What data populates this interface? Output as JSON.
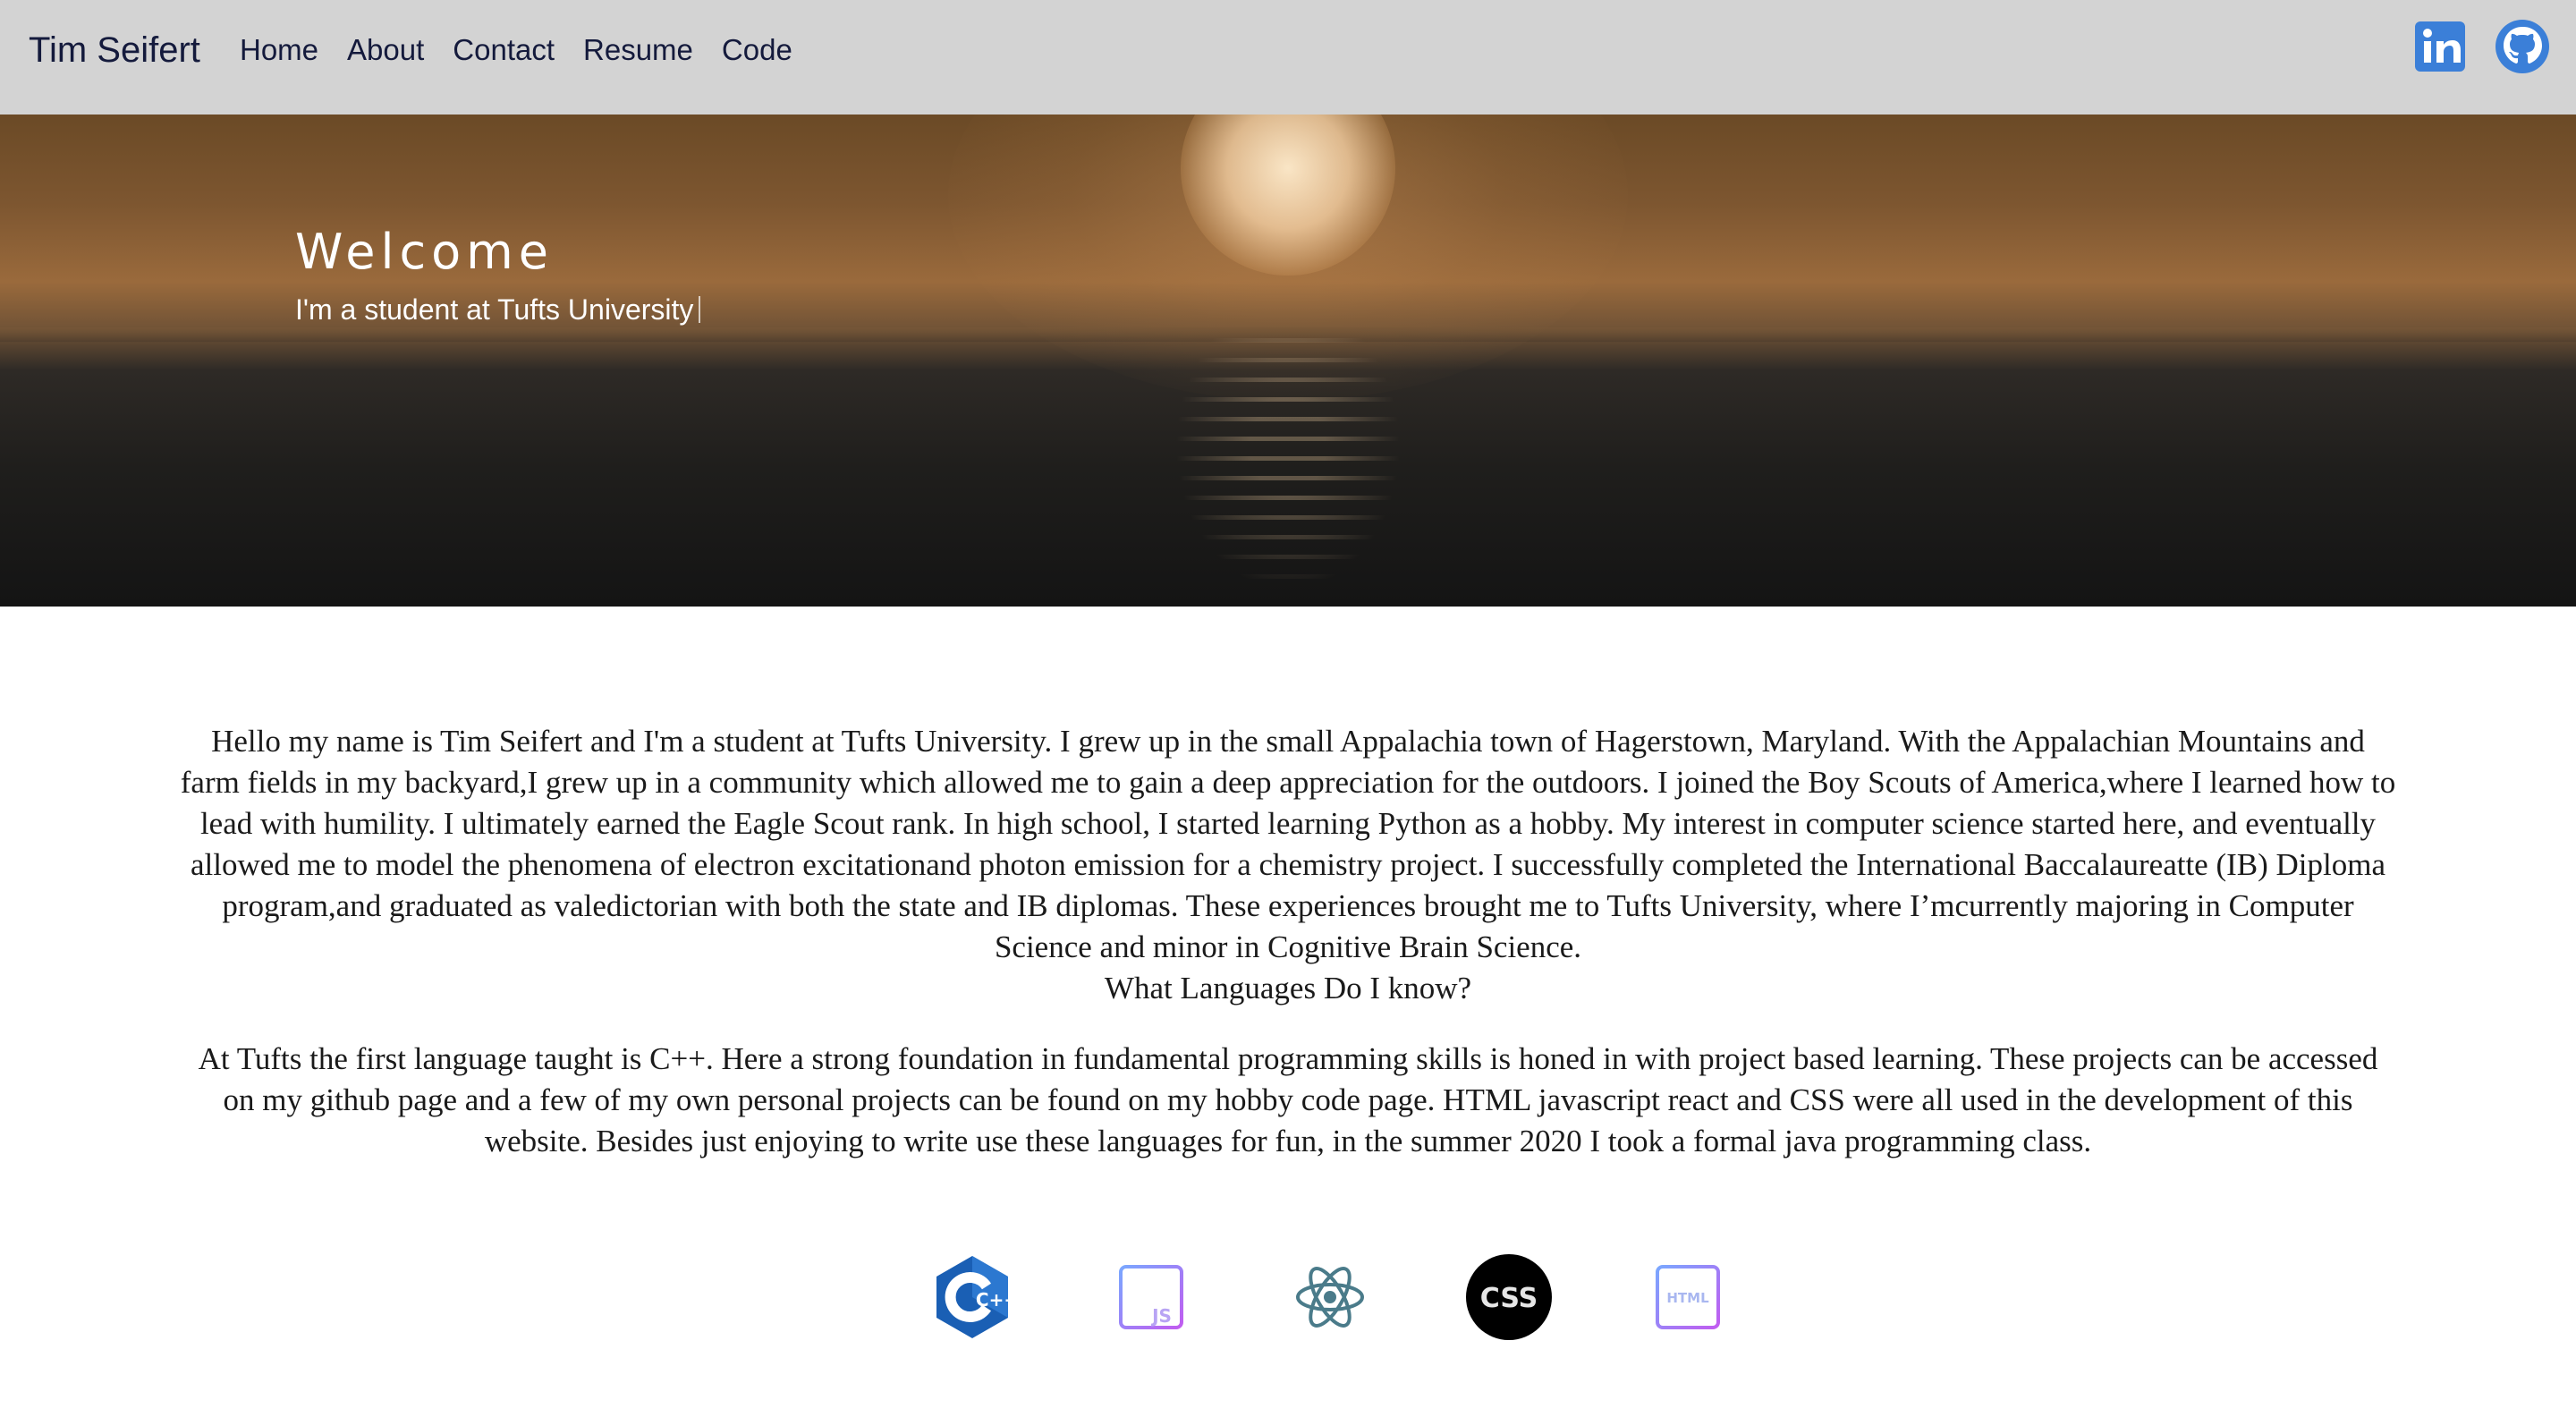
{
  "nav": {
    "brand": "Tim Seifert",
    "links": [
      "Home",
      "About",
      "Contact",
      "Resume",
      "Code"
    ],
    "social": [
      {
        "name": "linkedin-icon",
        "color": "#3b7fd8"
      },
      {
        "name": "github-icon",
        "color": "#3b7fd8"
      }
    ]
  },
  "hero": {
    "title": "Welcome",
    "subtitle": "I'm a student at Tufts University"
  },
  "about": {
    "bio": "Hello my name is Tim Seifert and I'm a student at Tufts University. I grew up in the small Appalachia town of Hagerstown, Maryland. With the Appalachian Mountains and farm fields in my backyard,I grew up in a community which allowed me to gain a deep appreciation for the outdoors. I joined the Boy Scouts of America,where I learned how to lead with humility. I ultimately earned the Eagle Scout rank. In high school, I started learning Python as a hobby. My interest in computer science started here, and eventually allowed me to model the phenomena of electron excitationand photon emission for a chemistry project. I successfully completed the International Baccalaureatte (IB) Diploma program,and graduated as valedictorian with both the state and IB diplomas. These experiences brought me to Tufts University, where I’mcurrently majoring in Computer Science and minor in Cognitive Brain Science.",
    "languages_heading": "What Languages Do I know?",
    "languages_text": "At Tufts the first language taught is C++. Here a strong foundation in fundamental programming skills is honed in with project based learning. These projects can be accessed on my github page and a few of my own personal projects can be found on my hobby code page. HTML javascript react and CSS were all used in the development of this website. Besides just enjoying to write use these languages for fun, in the summer 2020 I took a formal java programming class."
  },
  "icons": {
    "cpp": {
      "name": "cpp-icon",
      "label": "C++",
      "color": "#1a5fb4"
    },
    "js": {
      "name": "javascript-icon",
      "label": "JS"
    },
    "react": {
      "name": "react-icon",
      "color": "#4a7b8a"
    },
    "css": {
      "name": "css-icon",
      "label": "CSS"
    },
    "html": {
      "name": "html-icon",
      "label": "HTML"
    }
  },
  "colors": {
    "navbar_bg": "#d3d3d3",
    "nav_text": "#141a3c",
    "accent": "#3b7fd8",
    "body_text": "#1a1a1a"
  }
}
